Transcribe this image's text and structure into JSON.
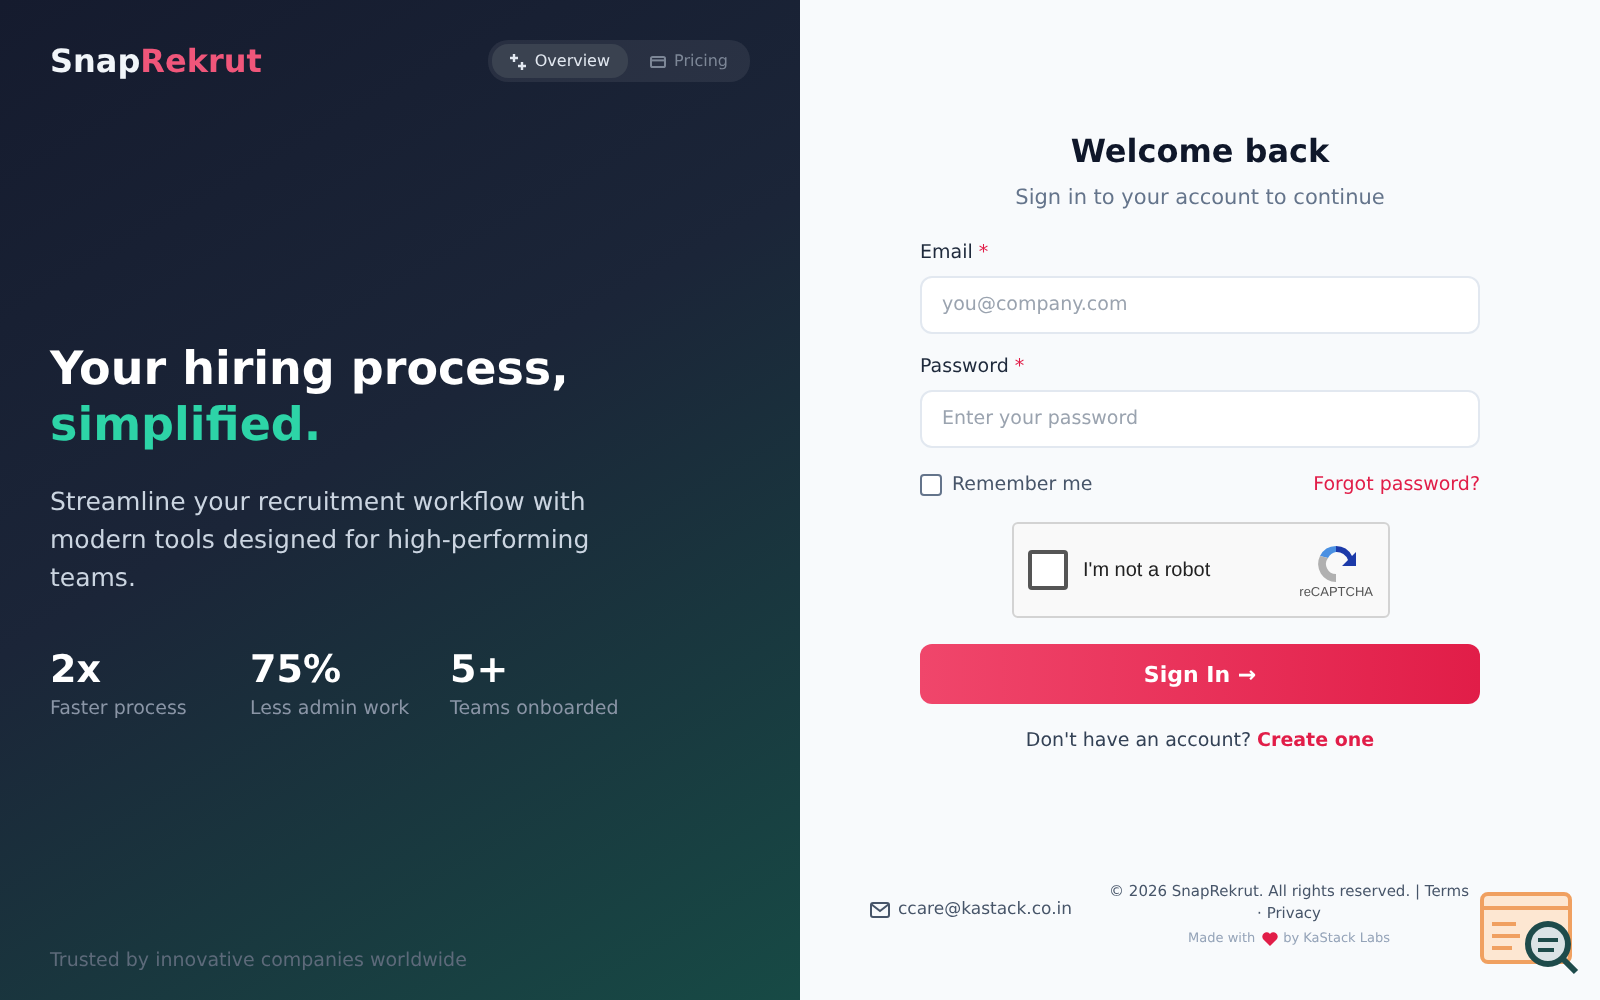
{
  "brand": {
    "parts": [
      {
        "text": "Snap",
        "accent": false
      },
      {
        "text": "Rekrut",
        "accent": true
      }
    ]
  },
  "nav": [
    {
      "label": "Overview",
      "kind": "sparkle",
      "selected": true
    },
    {
      "label": "Pricing",
      "kind": "card",
      "selected": false
    }
  ],
  "hero": {
    "title": "Your hiring process,",
    "highlight": "simplified.",
    "description": "Streamline your recruitment workflow with modern tools designed for high-performing teams."
  },
  "stats": [
    {
      "value": "2x",
      "label": "Faster process"
    },
    {
      "value": "75%",
      "label": "Less admin work"
    },
    {
      "value": "5+",
      "label": "Teams onboarded"
    }
  ],
  "trusted": "Trusted by innovative companies worldwide",
  "login": {
    "title": "Welcome back",
    "subtitle": "Sign in to your account to continue",
    "fields": [
      {
        "label": "Email",
        "required_mark": "*",
        "placeholder": "you@company.com"
      },
      {
        "label": "Password",
        "required_mark": "*",
        "placeholder": "Enter your password"
      }
    ],
    "remember": {
      "label": "Remember me",
      "checked": false
    },
    "forgot": "Forgot password?",
    "captcha": {
      "label": "I'm not a robot",
      "brand": "reCAPTCHA",
      "checked": false
    },
    "submit": {
      "label": "Sign In",
      "arrow": "→"
    },
    "signup": {
      "text": "Don't have an account?",
      "link": "Create one"
    }
  },
  "footer": {
    "email": "ccare@kastack.co.in",
    "copyright": "© 2026 SnapRekrut. All rights reserved. |",
    "terms": "Terms",
    "separator": "·",
    "privacy": "Privacy",
    "made_before": "Made with",
    "made_after": "by KaStack Labs"
  }
}
